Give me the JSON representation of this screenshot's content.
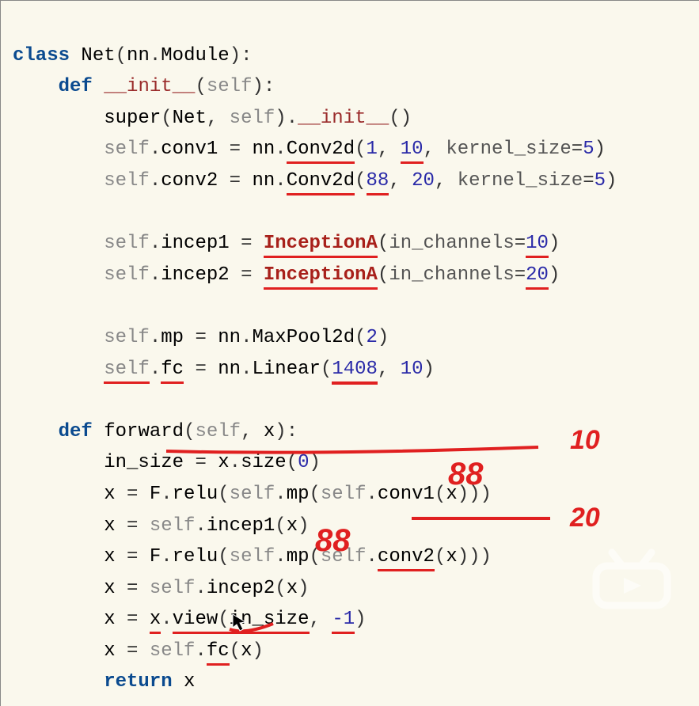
{
  "code": {
    "kw_class": "class",
    "net": "Net",
    "nn": "nn",
    "module": "Module",
    "kw_def": "def",
    "init": "__init__",
    "self": "self",
    "super": "super",
    "conv1": "conv1",
    "conv2": "conv2",
    "conv2d": "Conv2d",
    "incep1": "incep1",
    "incep2": "incep2",
    "inceptionA": "InceptionA",
    "in_channels": "in_channels",
    "mp": "mp",
    "maxpool2d": "MaxPool2d",
    "fc": "fc",
    "linear": "Linear",
    "forward": "forward",
    "x": "x",
    "in_size": "in_size",
    "size": "size",
    "F": "F",
    "relu": "relu",
    "view": "view",
    "kw_return": "return",
    "kernel_size": "kernel_size",
    "n1": "1",
    "n10": "10",
    "n88": "88",
    "n20": "20",
    "n2": "2",
    "n1408": "1408",
    "n5": "5",
    "n0": "0",
    "nm1": "-1"
  },
  "annotations": {
    "a10": "10",
    "a88": "88",
    "a20": "20",
    "a88b": "88"
  }
}
